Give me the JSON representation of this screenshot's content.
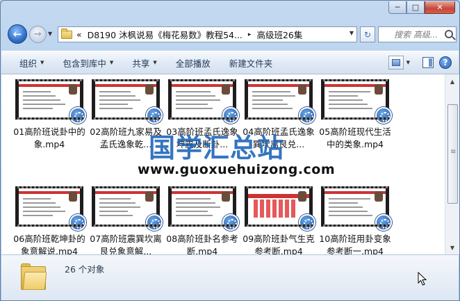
{
  "window": {
    "minimize_glyph": "─",
    "maximize_glyph": "□",
    "close_glyph": "✕"
  },
  "nav": {
    "back_glyph": "←",
    "forward_glyph": "→",
    "dropdown_glyph": "▼",
    "refresh_glyph": "↻"
  },
  "address": {
    "prefix": "«",
    "crumb1": "D8190 沐枫说易《梅花易数》教程54...",
    "sep": "▸",
    "crumb2": "高级班26集"
  },
  "search": {
    "placeholder": "搜索 高级..."
  },
  "toolbar": {
    "organize": "组织",
    "include_in_library": "包含到库中",
    "share": "共享",
    "play_all": "全部播放",
    "new_folder": "新建文件夹",
    "dropdown_glyph": "▼",
    "help_glyph": "?"
  },
  "files": [
    {
      "name": "01高阶班说卦中的象.mp4"
    },
    {
      "name": "02高阶班九家易及孟氏逸象乾..."
    },
    {
      "name": "03高阶班孟氏逸象坤震及断卦..."
    },
    {
      "name": "04高阶班孟氏逸象巽坎离艮兑..."
    },
    {
      "name": "05高阶班现代生活中的类象.mp4"
    },
    {
      "name": "06高阶班乾坤卦的象意解说.mp4"
    },
    {
      "name": "07高阶班震巽坎离艮兑象意解..."
    },
    {
      "name": "08高阶班卦名参考断.mp4"
    },
    {
      "name": "09高阶班卦气生克参考断.mp4"
    },
    {
      "name": "10高阶班用卦变象参考断一.mp4"
    }
  ],
  "watermark": {
    "cn": "国学汇总站",
    "url": "www.guoxuehuizong.com"
  },
  "details": {
    "count": "26 个对象"
  },
  "scrollbar": {
    "up_glyph": "▲",
    "down_glyph": "▼"
  }
}
